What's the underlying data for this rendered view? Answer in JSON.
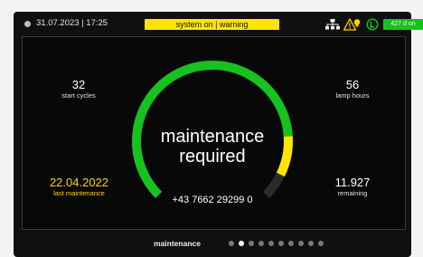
{
  "status_bar": {
    "datetime": "31.07.2023 | 17:25",
    "system_status": "system on | warning",
    "lamp_status": "427 d on",
    "icons": [
      "network-icon",
      "warning-bulb-icon",
      "circle-l-icon"
    ]
  },
  "stats": {
    "start_cycles": {
      "value": "32",
      "label": "start cycles"
    },
    "lamp_hours": {
      "value": "56",
      "label": "lamp hours"
    },
    "last_maintenance": {
      "value": "22.04.2022",
      "label": "last maintenance"
    },
    "remaining": {
      "value": "11.927",
      "label": "remaining"
    }
  },
  "main": {
    "message_line1": "maintenance",
    "message_line2": "required",
    "phone": "+43 7662 29299 0"
  },
  "gauge": {
    "fill_fraction": 0.82,
    "warning_fraction": 0.11
  },
  "footer": {
    "label": "maintenance",
    "page_count": 10,
    "active_page": 2
  },
  "colors": {
    "accent_green": "#16c21e",
    "warning_yellow": "#ffe500",
    "background": "#101010"
  }
}
